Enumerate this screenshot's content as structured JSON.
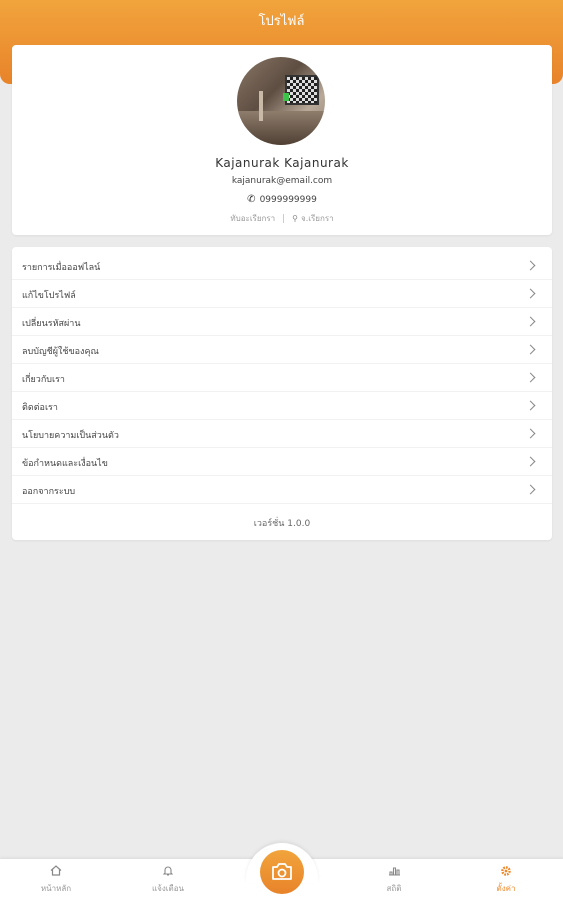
{
  "header": {
    "title": "โปรไฟล์"
  },
  "profile": {
    "name": "Kajanurak  Kajanurak",
    "email": "kajanurak@email.com",
    "phone": "0999999999",
    "district": "ทับอะเรียกรา",
    "province": "จ.เรียกรา"
  },
  "menu": {
    "items": [
      {
        "label": "รายการเมื่อออฟไลน์"
      },
      {
        "label": "แก้ไขโปรไฟล์"
      },
      {
        "label": "เปลี่ยนรหัสผ่าน"
      },
      {
        "label": "ลบบัญชีผู้ใช้ของคุณ"
      },
      {
        "label": "เกี่ยวกับเรา"
      },
      {
        "label": "ติดต่อเรา"
      },
      {
        "label": "นโยบายความเป็นส่วนตัว"
      },
      {
        "label": "ข้อกำหนดและเงื่อนไข"
      },
      {
        "label": "ออกจากระบบ"
      }
    ],
    "version": "เวอร์ชั่น 1.0.0"
  },
  "nav": {
    "items": [
      {
        "label": "หน้าหลัก",
        "icon": "home-icon"
      },
      {
        "label": "แจ้งเตือน",
        "icon": "bell-icon"
      },
      {
        "label": "สถิติ",
        "icon": "stats-icon"
      },
      {
        "label": "ตั้งค่า",
        "icon": "gear-icon"
      }
    ],
    "active": "ตั้งค่า"
  },
  "colors": {
    "accent": "#ee8a2c",
    "header_top": "#f1a43c",
    "header_bottom": "#e8832a",
    "background": "#ebebeb"
  }
}
